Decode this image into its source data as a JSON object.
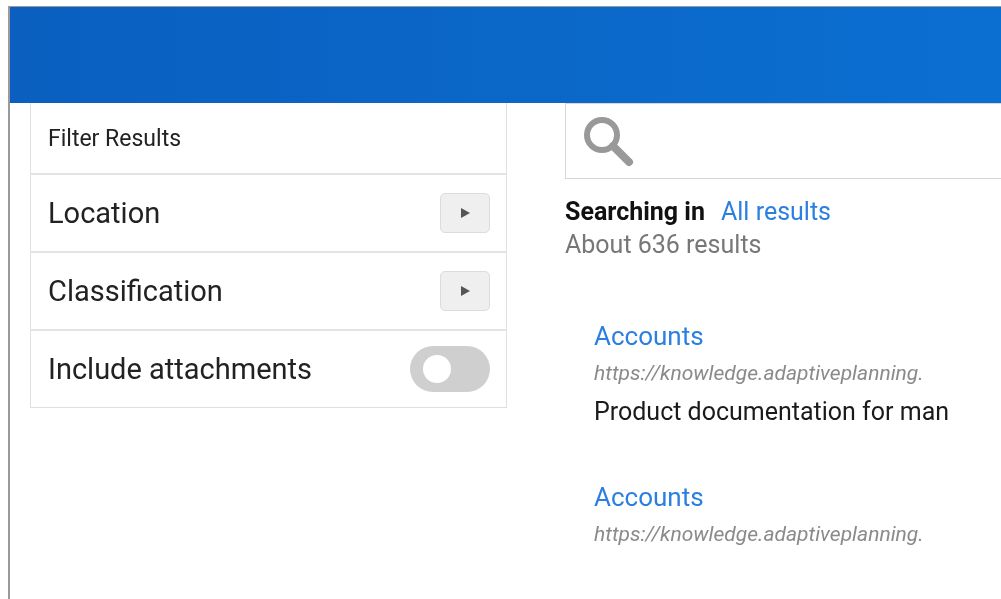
{
  "filter_panel": {
    "title": "Filter Results",
    "filters": [
      {
        "kind": "expand",
        "label": "Location"
      },
      {
        "kind": "expand",
        "label": "Classification"
      },
      {
        "kind": "toggle",
        "label": "Include attachments",
        "on": false
      }
    ]
  },
  "search": {
    "searching_label": "Searching in",
    "scope": "All results",
    "count": "About 636 results"
  },
  "results": [
    {
      "title": "Accounts",
      "url": "https://knowledge.adaptiveplanning.",
      "description": "Product documentation for man"
    },
    {
      "title": "Accounts",
      "url": "https://knowledge.adaptiveplanning."
    }
  ]
}
